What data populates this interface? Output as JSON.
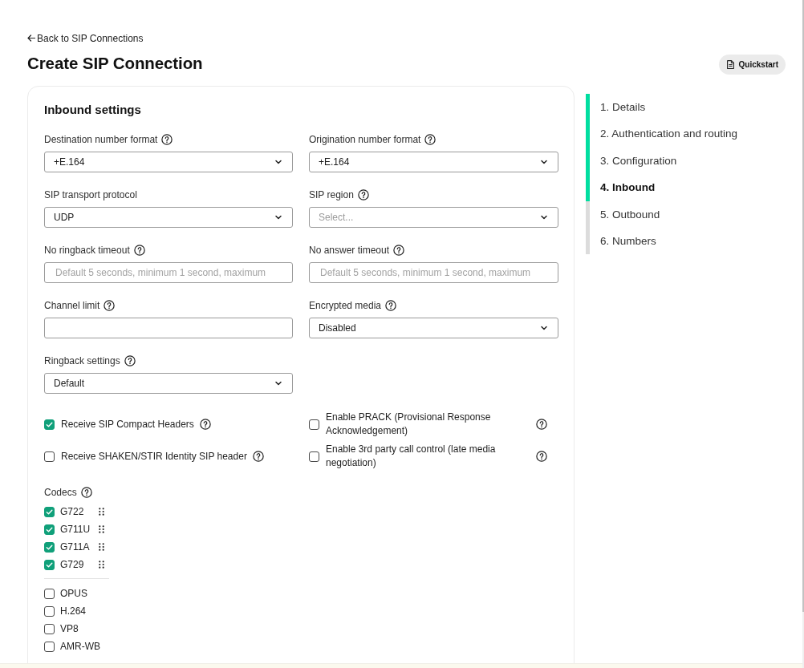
{
  "back_link": {
    "label": "Back to SIP Connections"
  },
  "header": {
    "title": "Create SIP Connection",
    "quickstart_button": {
      "label": "Quickstart"
    }
  },
  "inbound_settings": {
    "title": "Inbound settings",
    "fields": [
      {
        "kind": "select",
        "label": "Destination number format",
        "help": true,
        "value": "+E.164"
      },
      {
        "kind": "select",
        "label": "Origination number format",
        "help": true,
        "value": "+E.164"
      },
      {
        "kind": "select",
        "label": "SIP transport protocol",
        "help": false,
        "value": "UDP"
      },
      {
        "kind": "select",
        "label": "SIP region",
        "help": true,
        "placeholder": "Select..."
      },
      {
        "kind": "input",
        "label": "No ringback timeout",
        "help": true,
        "placeholder": "Default 5 seconds, minimum 1 second, maximum"
      },
      {
        "kind": "input",
        "label": "No answer timeout",
        "help": true,
        "placeholder": "Default 5 seconds, minimum 1 second, maximum"
      },
      {
        "kind": "input",
        "label": "Channel limit",
        "help": true
      },
      {
        "kind": "select",
        "label": "Encrypted media",
        "help": true,
        "value": "Disabled"
      },
      {
        "kind": "select",
        "label": "Ringback settings",
        "help": true,
        "value": "Default"
      }
    ],
    "options": [
      {
        "label": "Receive SIP Compact Headers",
        "checked": true,
        "help": true
      },
      {
        "label": "Enable PRACK (Provisional Response Acknowledgement)",
        "checked": false,
        "help": true
      },
      {
        "label": "Receive SHAKEN/STIR Identity SIP header",
        "checked": false,
        "help": true
      },
      {
        "label": "Enable 3rd party call control (late media negotiation)",
        "checked": false,
        "help": true
      }
    ],
    "codecs": {
      "label": "Codecs",
      "help": true,
      "ordered": [
        {
          "name": "G722",
          "checked": true
        },
        {
          "name": "G711U",
          "checked": true
        },
        {
          "name": "G711A",
          "checked": true
        },
        {
          "name": "G729",
          "checked": true
        }
      ],
      "available": [
        {
          "name": "OPUS",
          "checked": false
        },
        {
          "name": "H.264",
          "checked": false
        },
        {
          "name": "VP8",
          "checked": false
        },
        {
          "name": "AMR-WB",
          "checked": false
        }
      ]
    }
  },
  "steps": [
    {
      "label": "1. Details",
      "done": true,
      "selected": false
    },
    {
      "label": "2. Authentication and routing",
      "done": true,
      "selected": false
    },
    {
      "label": "3. Configuration",
      "done": true,
      "selected": false
    },
    {
      "label": "4. Inbound",
      "done": false,
      "selected": true
    },
    {
      "label": "5. Outbound",
      "done": false,
      "selected": false
    },
    {
      "label": "6. Numbers",
      "done": false,
      "selected": false
    }
  ]
}
